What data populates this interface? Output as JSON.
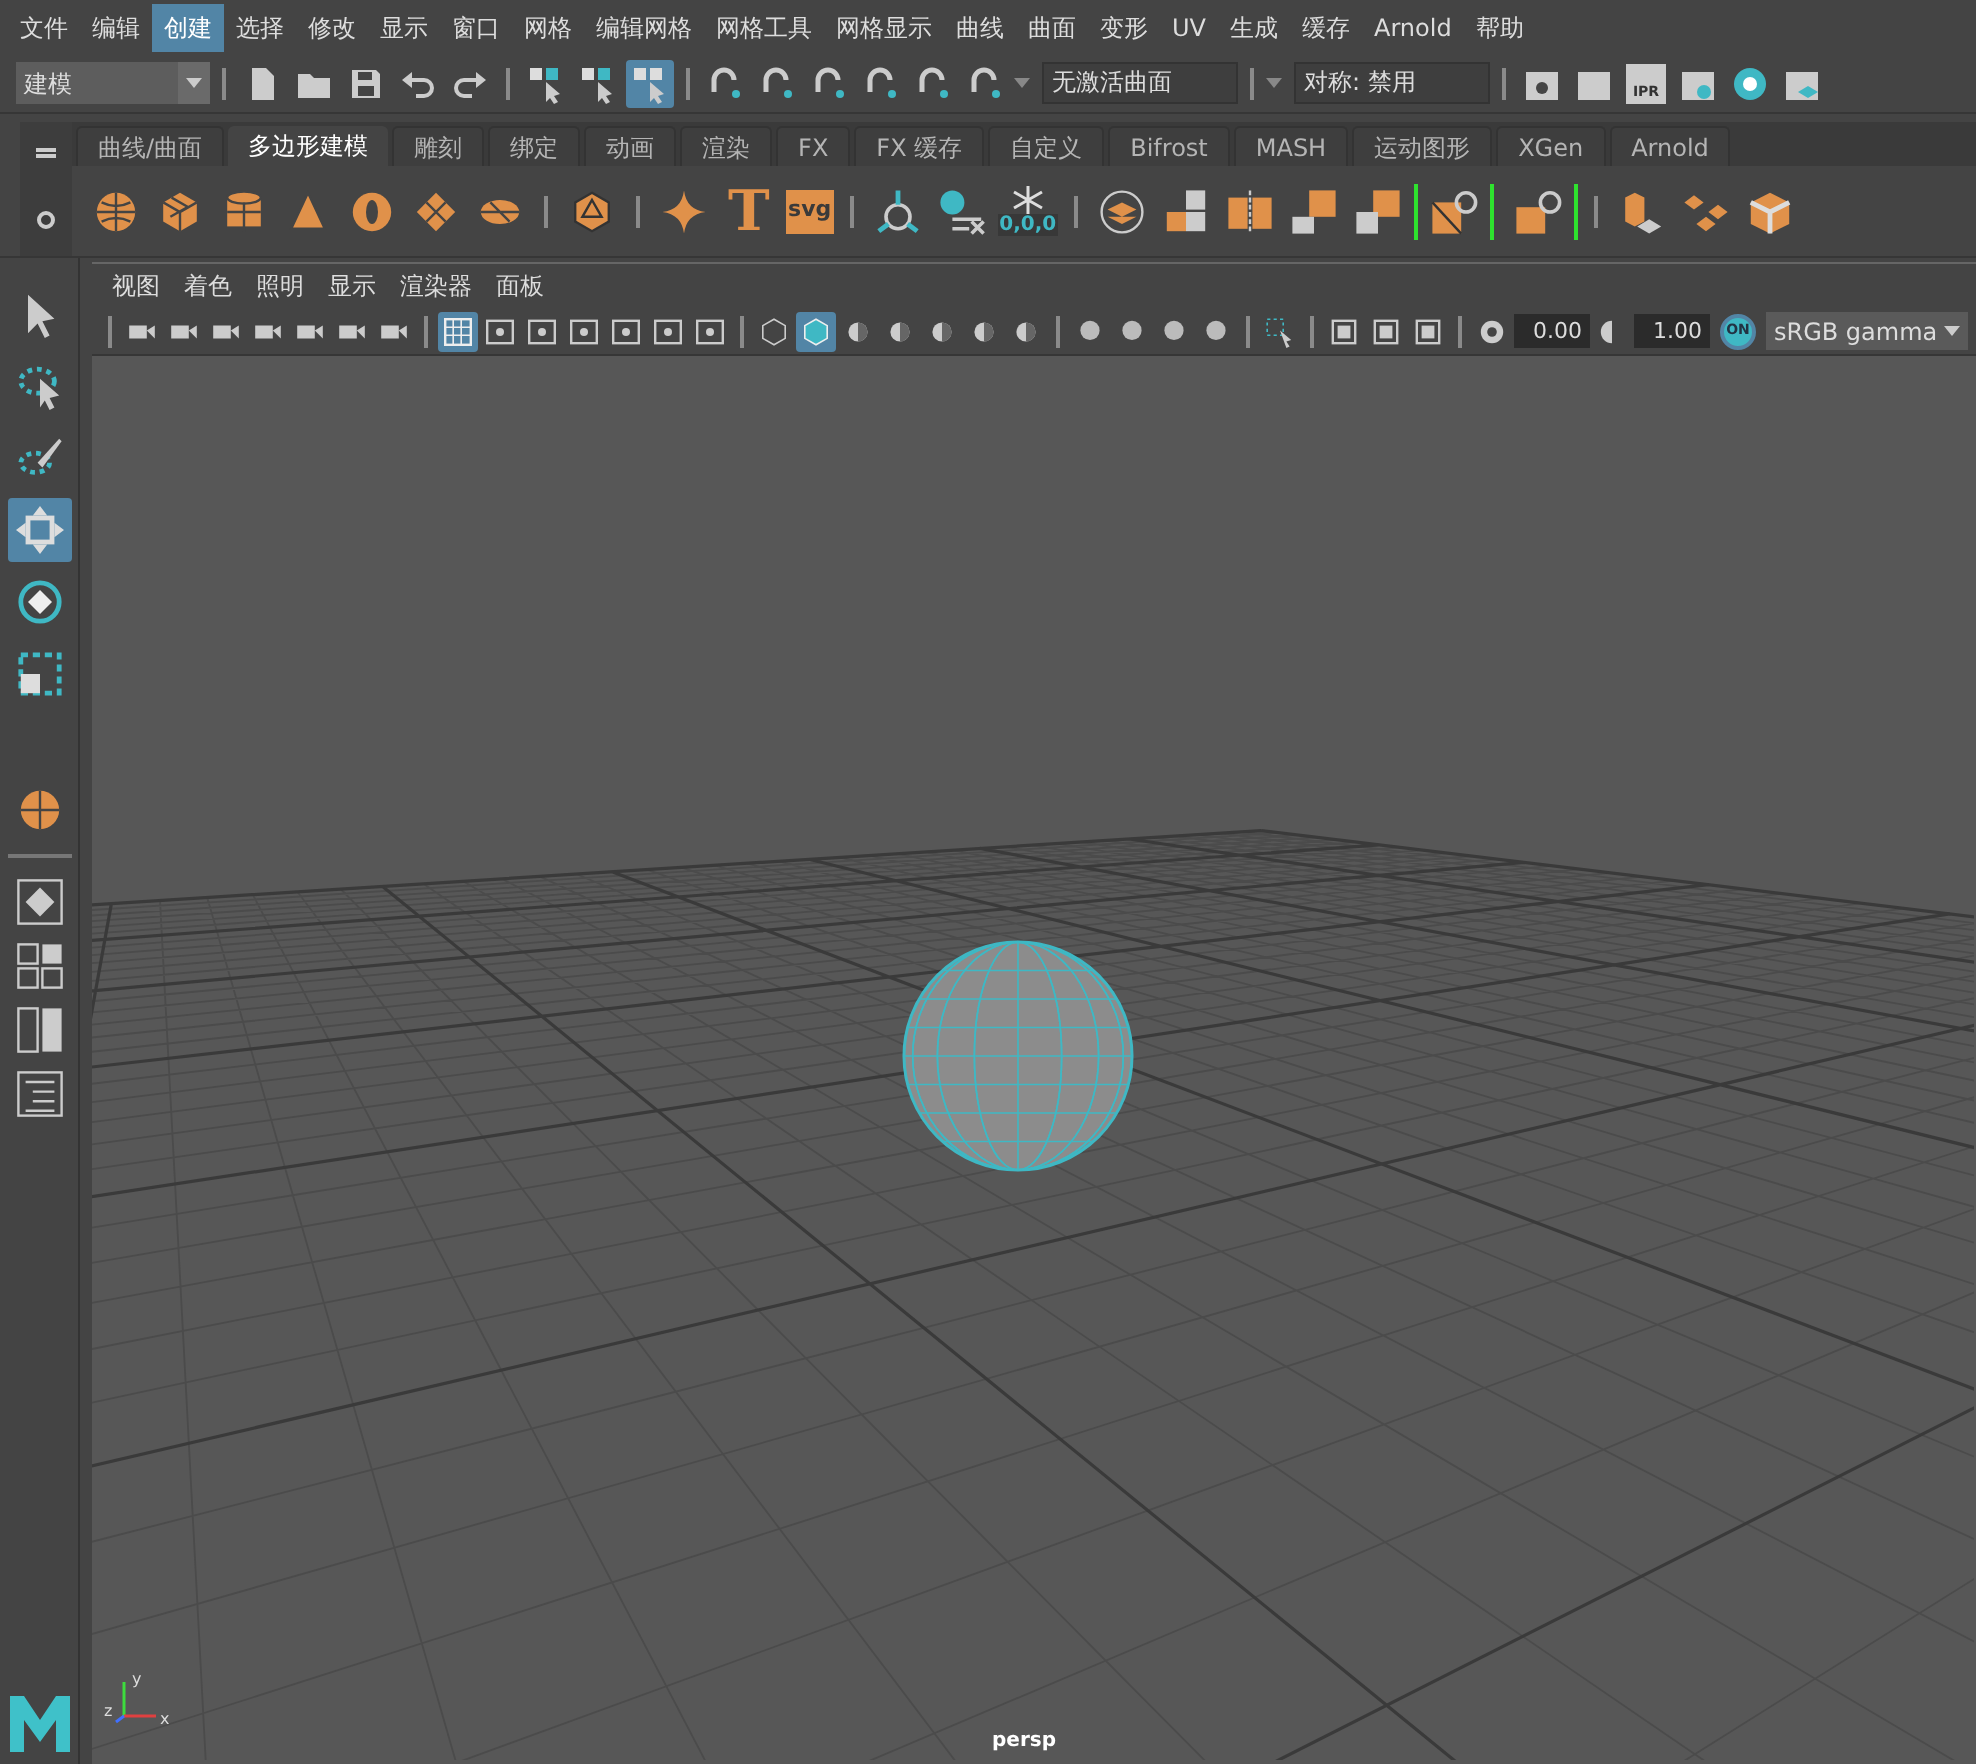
{
  "menu_bar": [
    {
      "label": "文件",
      "selected": false
    },
    {
      "label": "编辑",
      "selected": false
    },
    {
      "label": "创建",
      "selected": true
    },
    {
      "label": "选择",
      "selected": false
    },
    {
      "label": "修改",
      "selected": false
    },
    {
      "label": "显示",
      "selected": false
    },
    {
      "label": "窗口",
      "selected": false
    },
    {
      "label": "网格",
      "selected": false
    },
    {
      "label": "编辑网格",
      "selected": false
    },
    {
      "label": "网格工具",
      "selected": false
    },
    {
      "label": "网格显示",
      "selected": false
    },
    {
      "label": "曲线",
      "selected": false
    },
    {
      "label": "曲面",
      "selected": false
    },
    {
      "label": "变形",
      "selected": false
    },
    {
      "label": "UV",
      "selected": false
    },
    {
      "label": "生成",
      "selected": false
    },
    {
      "label": "缓存",
      "selected": false
    },
    {
      "label": "Arnold",
      "selected": false
    },
    {
      "label": "帮助",
      "selected": false
    }
  ],
  "status_line": {
    "mode_dropdown": "建模",
    "selection_masks": [
      {
        "kind": "hierarchy",
        "selected": false
      },
      {
        "kind": "object",
        "selected": false
      },
      {
        "kind": "component",
        "selected": true
      }
    ],
    "live_surface_field": "无激活曲面",
    "symmetry_field": "对称: 禁用",
    "render_label": "IPR"
  },
  "shelf": {
    "tabs": [
      {
        "label": "曲线/曲面",
        "selected": false
      },
      {
        "label": "多边形建模",
        "selected": true
      },
      {
        "label": "雕刻",
        "selected": false
      },
      {
        "label": "绑定",
        "selected": false
      },
      {
        "label": "动画",
        "selected": false
      },
      {
        "label": "渲染",
        "selected": false
      },
      {
        "label": "FX",
        "selected": false
      },
      {
        "label": "FX 缓存",
        "selected": false
      },
      {
        "label": "自定义",
        "selected": false
      },
      {
        "label": "Bifrost",
        "selected": false
      },
      {
        "label": "MASH",
        "selected": false
      },
      {
        "label": "运动图形",
        "selected": false
      },
      {
        "label": "XGen",
        "selected": false
      },
      {
        "label": "Arnold",
        "selected": false
      }
    ],
    "text_icon_label": "T",
    "svg_icon_label": "svg",
    "freeze_label": "0,0,0"
  },
  "toolbox": {
    "tools": [
      {
        "kind": "select",
        "selected": false
      },
      {
        "kind": "lasso",
        "selected": false
      },
      {
        "kind": "paint",
        "selected": false
      },
      {
        "kind": "move",
        "selected": true
      },
      {
        "kind": "rotate",
        "selected": false
      },
      {
        "kind": "scale",
        "selected": false
      }
    ]
  },
  "viewport": {
    "menu": [
      "视图",
      "着色",
      "照明",
      "显示",
      "渲染器",
      "面板"
    ],
    "grid_toggle": {
      "selected": true
    },
    "shaded_toggle": {
      "selected": true
    },
    "exposure": "0.00",
    "gamma": "1.00",
    "color_management": {
      "label": "ON",
      "on": true
    },
    "color_space": "sRGB gamma",
    "axis_labels": {
      "x": "x",
      "y": "y",
      "z": "z"
    },
    "camera_label": "persp"
  }
}
